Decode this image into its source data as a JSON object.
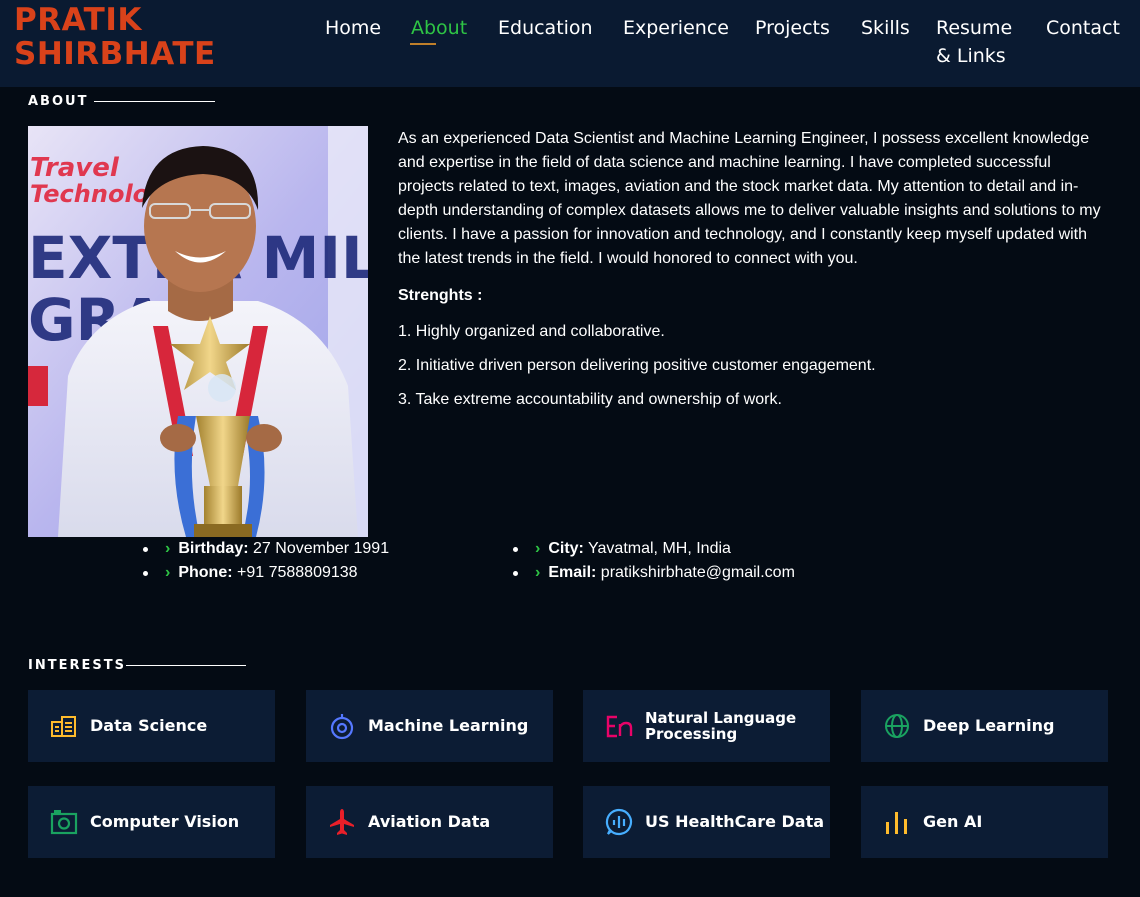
{
  "header": {
    "logo_line1": "PRATIK",
    "logo_line2": "SHIRBHATE",
    "nav": [
      "Home",
      "About",
      "Education",
      "Experience",
      "Projects",
      "Skills",
      "Resume",
      "& Links",
      "Contact"
    ],
    "active": "About"
  },
  "about": {
    "title": "ABOUT",
    "paragraph": "As an experienced Data Scientist and Machine Learning Engineer, I possess excellent knowledge and expertise in the field of data science and machine learning. I have completed successful projects related to text, images, aviation and the stock market data. My attention to detail and in-depth understanding of complex datasets allows me to deliver valuable insights and solutions to my clients. I have a passion for innovation and technology, and I constantly keep myself updated with the latest trends in the field. I would honored to connect with you.",
    "strengths_heading": "Strenghts :",
    "strengths": [
      "1. Highly organized and collaborative.",
      "2. Initiative driven person delivering positive customer engagement.",
      "3. Take extreme accountability and ownership of work."
    ],
    "photo_text": [
      "Travel",
      "Technolo",
      "EXTRA MILE",
      "GRA"
    ],
    "details": {
      "birthday_label": "Birthday:",
      "birthday": "27 November 1991",
      "phone_label": "Phone:",
      "phone": "+91 7588809138",
      "city_label": "City:",
      "city": "Yavatmal, MH, India",
      "email_label": "Email:",
      "email": "pratikshirbhate@gmail.com"
    }
  },
  "interests": {
    "title": "INTERESTS",
    "items": [
      {
        "label": "Data Science",
        "icon": "data-science-icon",
        "color": "#ffbb2c"
      },
      {
        "label": "Machine Learning",
        "icon": "machine-learning-icon",
        "color": "#5578ff"
      },
      {
        "label": "Natural Language Processing",
        "icon": "language-icon",
        "color": "#e80368"
      },
      {
        "label": "Deep Learning",
        "icon": "globe-icon",
        "color": "#11dbcf"
      },
      {
        "label": "Computer Vision",
        "icon": "camera-icon",
        "color": "#47aeff"
      },
      {
        "label": "Aviation Data",
        "icon": "airplane-icon",
        "color": "#e81f29"
      },
      {
        "label": "US HealthCare Data",
        "icon": "healthcare-icon",
        "color": "#47aeff"
      },
      {
        "label": "Gen AI",
        "icon": "bar-chart-icon",
        "color": "#ffa76e"
      }
    ]
  },
  "colors": {
    "accent": "#2ec445",
    "logo": "#d9421a",
    "background": "#040b14",
    "header": "#0a1a31",
    "card": "#0c1c34"
  }
}
